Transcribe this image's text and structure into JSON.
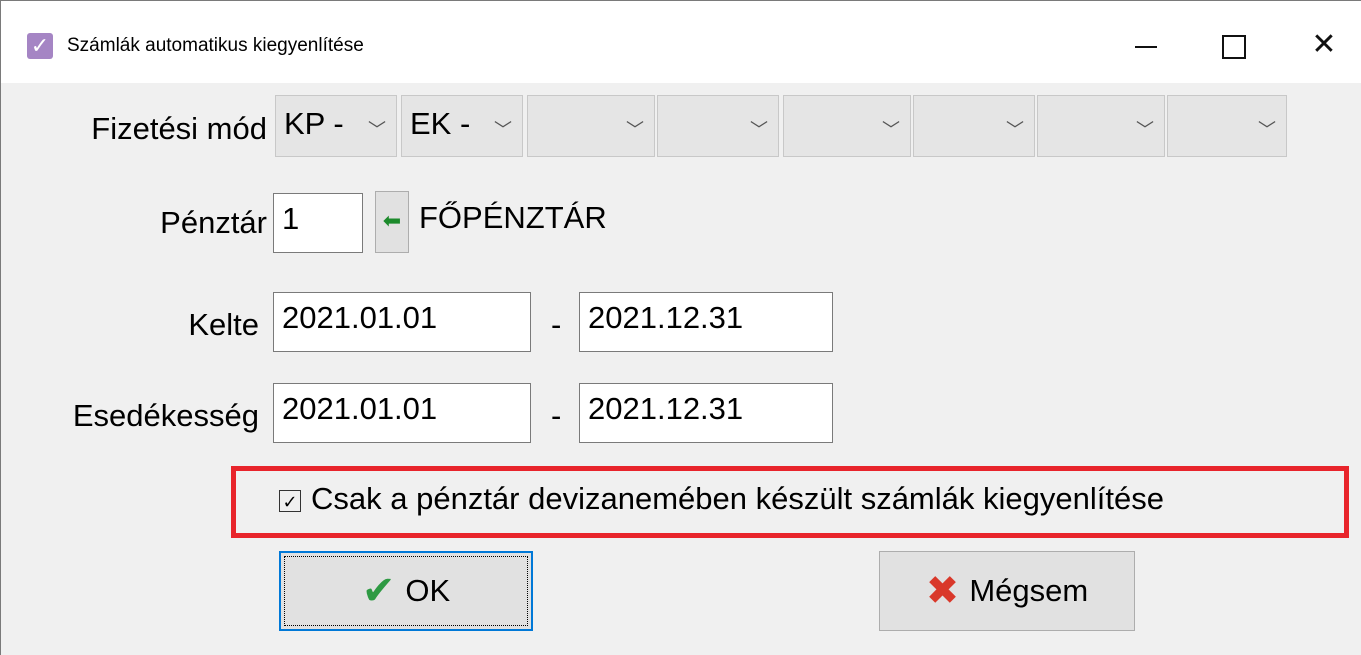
{
  "window": {
    "title": "Számlák automatikus kiegyenlítése",
    "minimize": "—",
    "maximize": "□",
    "close": "✕"
  },
  "form": {
    "fizetesi_mod_label": "Fizetési mód",
    "payment_modes": [
      "KP -",
      "EK -",
      "",
      "",
      "",
      "",
      "",
      ""
    ],
    "penztar_label": "Pénztár",
    "penztar_value": "1",
    "penztar_name": "FŐPÉNZTÁR",
    "kelte_label": "Kelte",
    "kelte_from": "2021.01.01",
    "kelte_to": "2021.12.31",
    "esedekesseg_label": "Esedékesség",
    "esedekesseg_from": "2021.01.01",
    "esedekesseg_to": "2021.12.31",
    "range_separator": "-",
    "checkbox_label": "Csak a pénztár devizanemében készült számlák kiegyenlítése",
    "checkbox_checked": true
  },
  "buttons": {
    "ok_label": "OK",
    "cancel_label": "Mégsem"
  },
  "colors": {
    "highlight": "#e8242b",
    "ok_icon": "#2e9a43",
    "cancel_icon": "#d9382a",
    "app_icon": "#a585c4"
  },
  "icons": {
    "app": "check-icon",
    "ok": "checkmark-icon",
    "cancel": "x-icon",
    "lookup": "arrow-left-icon"
  }
}
